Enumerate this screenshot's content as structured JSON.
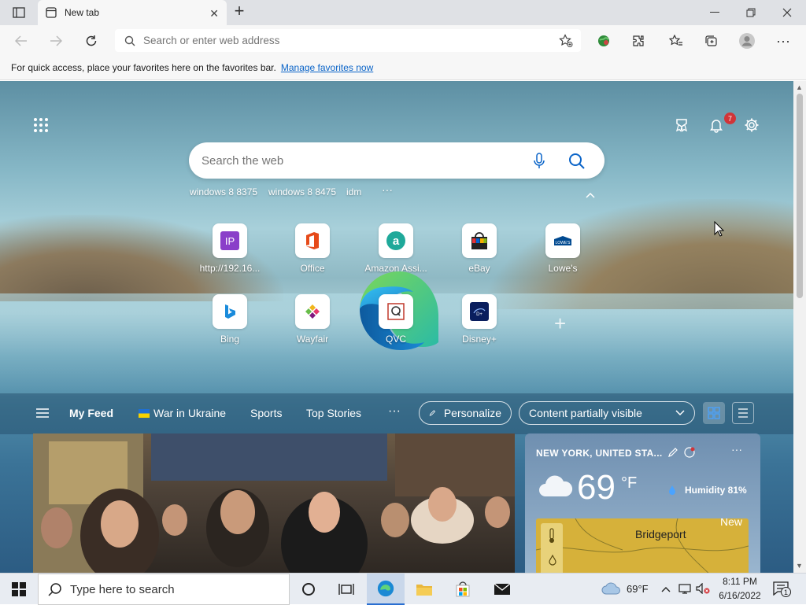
{
  "window": {
    "tab_title": "New tab",
    "address_placeholder": "Search or enter web address"
  },
  "favorites_bar": {
    "message": "For quick access, place your favorites here on the favorites bar.",
    "link": "Manage favorites now"
  },
  "newtab": {
    "notification_count": "7",
    "search_placeholder": "Search the web",
    "suggestions": [
      "windows 8 8375",
      "windows 8 8475",
      "idm",
      "···"
    ],
    "tiles": [
      {
        "label": "http://192.16...",
        "icon": "ip-icon"
      },
      {
        "label": "Office",
        "icon": "office-icon"
      },
      {
        "label": "Amazon Assi...",
        "icon": "amazon-assistant-icon"
      },
      {
        "label": "eBay",
        "icon": "ebay-icon"
      },
      {
        "label": "Lowe's",
        "icon": "lowes-icon"
      },
      {
        "label": "Bing",
        "icon": "bing-icon"
      },
      {
        "label": "Wayfair",
        "icon": "wayfair-icon"
      },
      {
        "label": "QVC",
        "icon": "qvc-icon"
      },
      {
        "label": "Disney+",
        "icon": "disney-plus-icon"
      }
    ],
    "add_tile": "+"
  },
  "feed": {
    "my_feed": "My Feed",
    "tabs": [
      "War in Ukraine",
      "Sports",
      "Top Stories"
    ],
    "more": "···",
    "personalize": "Personalize",
    "content_visibility": "Content partially visible"
  },
  "weather": {
    "location": "NEW YORK, UNITED STA...",
    "temperature": "69",
    "unit": "°F",
    "humidity": "Humidity 81%",
    "map_label_1": "Bridgeport",
    "map_label_2": "New"
  },
  "taskbar": {
    "search_placeholder": "Type here to search",
    "weather": "69°F",
    "time": "8:11 PM",
    "date": "6/16/2022",
    "notifications": "1"
  },
  "colors": {
    "accent": "#0a64c8",
    "badge": "#d13438"
  }
}
